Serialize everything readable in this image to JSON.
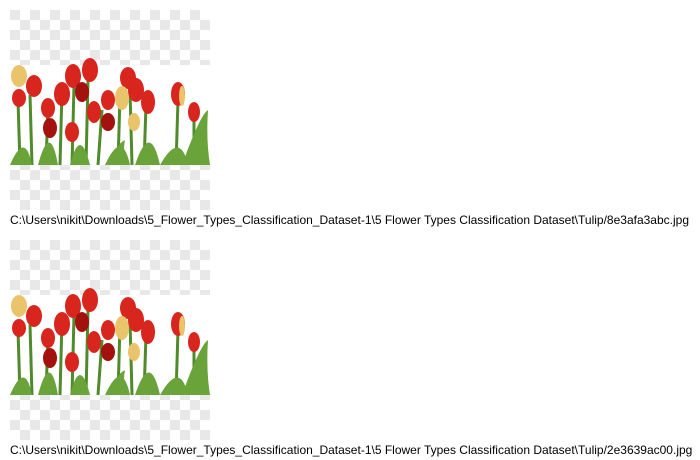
{
  "results": [
    {
      "path": "C:\\Users\\nikit\\Downloads\\5_Flower_Types_Classification_Dataset-1\\5 Flower Types Classification Dataset\\Tulip/8e3afa3abc.jpg",
      "image_subject": "red-tulips-on-transparent-background"
    },
    {
      "path": "C:\\Users\\nikit\\Downloads\\5_Flower_Types_Classification_Dataset-1\\5 Flower Types Classification Dataset\\Tulip/2e3639ac00.jpg",
      "image_subject": "red-tulips-on-transparent-background"
    }
  ],
  "colors": {
    "checker_light": "#ffffff",
    "checker_dark": "#e8e8e8",
    "tulip_red": "#d8251e",
    "tulip_dark_red": "#a3120f",
    "tulip_yellow": "#e9c46a",
    "stem_green": "#4f8a2b",
    "leaf_green": "#6aa33a"
  }
}
